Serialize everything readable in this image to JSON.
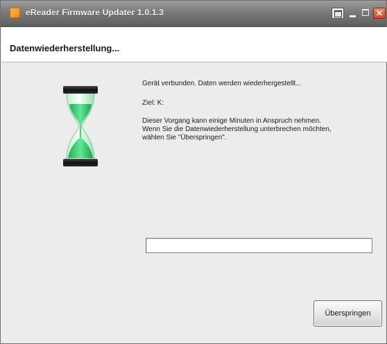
{
  "window": {
    "title": "eReader Firmware Updater 1.0.1.3"
  },
  "titlebar_icons": {
    "app": "app-icon",
    "restore": "restore-icon",
    "minimize": "minimize-icon",
    "maximize": "maximize-icon",
    "close": "close-icon",
    "close_glyph": "✕"
  },
  "header": {
    "title": "Datenwiederherstellung..."
  },
  "content": {
    "status_icon": "hourglass-icon",
    "status_line": "Gerät verbunden. Daten werden wiederhergestellt...",
    "target_line": "Ziel: K:",
    "info_line_1": "Dieser Vorgang kann einige Minuten in Anspruch nehmen.",
    "info_line_2": "Wenn Sie die Datenwiederherstellung unterbrechen möchten,",
    "info_line_3": "wählen Sie \"Überspringen\"."
  },
  "progress": {
    "value_percent": 0
  },
  "buttons": {
    "skip_label": "Überspringen"
  },
  "colors": {
    "titlebar": "#7a7a7a",
    "close_button": "#d8461f",
    "hourglass_sand": "#3fd37a",
    "hourglass_cap": "#1e1e1e"
  }
}
